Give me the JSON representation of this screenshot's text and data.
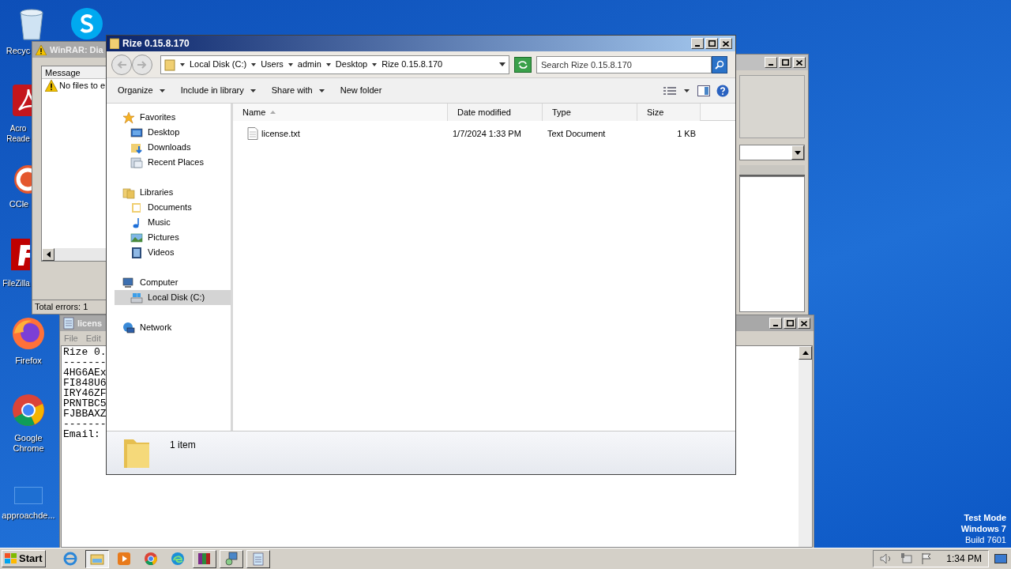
{
  "desktop": {
    "icons": [
      {
        "kind": "recycle",
        "lines": [
          "Recyc"
        ]
      },
      {
        "kind": "skype"
      },
      {
        "kind": "acrobat",
        "lines": [
          "Acro",
          "Reade"
        ]
      },
      {
        "kind": "ccleaner",
        "lines": [
          "CCle"
        ]
      },
      {
        "kind": "filezilla",
        "lines": [
          "FileZilla"
        ]
      },
      {
        "kind": "firefox",
        "lines": [
          "Firefox"
        ]
      },
      {
        "kind": "chrome",
        "lines": [
          "Google",
          "Chrome"
        ]
      },
      {
        "kind": "blank",
        "lines": [
          "approachde..."
        ]
      }
    ],
    "test_mode": [
      "Test Mode",
      "Windows 7",
      "Build 7601"
    ]
  },
  "winrar_dialog": {
    "title": "WinRAR: Dia",
    "column": "Message",
    "row": "No files to e",
    "status": "Total errors: 1"
  },
  "notepad": {
    "title": "licens",
    "menu": [
      "File",
      "Edit"
    ],
    "lines": [
      "Rize 0.",
      "-------",
      "4HG6AEx",
      "FI848U6",
      "IRY46ZF",
      "PRNTBC5",
      "FJBBAXZ",
      "-------",
      "Email:"
    ]
  },
  "explorer": {
    "title": "Rize 0.15.8.170",
    "breadcrumbs": [
      "Local Disk (C:)",
      "Users",
      "admin",
      "Desktop",
      "Rize 0.15.8.170"
    ],
    "search": {
      "placeholder": "Search Rize 0.15.8.170"
    },
    "toolbar": [
      {
        "label": "Organize",
        "has_menu": true
      },
      {
        "label": "Include in library",
        "has_menu": true
      },
      {
        "label": "Share with",
        "has_menu": true
      },
      {
        "label": "New folder",
        "has_menu": false
      }
    ],
    "nav": [
      {
        "label": "Favorites",
        "kind": "star",
        "selected": false,
        "children": [
          {
            "label": "Desktop",
            "kind": "desktop",
            "selected": false
          },
          {
            "label": "Downloads",
            "kind": "downloads",
            "selected": false
          },
          {
            "label": "Recent Places",
            "kind": "recent",
            "selected": false
          }
        ]
      },
      {
        "label": "Libraries",
        "kind": "library",
        "selected": false,
        "children": [
          {
            "label": "Documents",
            "kind": "documents",
            "selected": false
          },
          {
            "label": "Music",
            "kind": "music",
            "selected": false
          },
          {
            "label": "Pictures",
            "kind": "pictures",
            "selected": false
          },
          {
            "label": "Videos",
            "kind": "videos",
            "selected": false
          }
        ]
      },
      {
        "label": "Computer",
        "kind": "computer",
        "selected": false,
        "children": [
          {
            "label": "Local Disk (C:)",
            "kind": "drive",
            "selected": true
          }
        ]
      },
      {
        "label": "Network",
        "kind": "network",
        "selected": false
      }
    ],
    "columns": [
      {
        "label": "Name",
        "sorted": true
      },
      {
        "label": "Date modified",
        "sorted": false
      },
      {
        "label": "Type",
        "sorted": false
      },
      {
        "label": "Size",
        "sorted": false
      }
    ],
    "rows": [
      {
        "name": "license.txt",
        "date": "1/7/2024 1:33 PM",
        "type": "Text Document",
        "size": "1 KB",
        "selected": false
      }
    ],
    "status": "1 item"
  },
  "taskbar": {
    "start": "Start",
    "apps": [
      {
        "kind": "ie",
        "active": false
      },
      {
        "kind": "explorer",
        "active": true
      },
      {
        "kind": "media",
        "active": false
      },
      {
        "kind": "chrome",
        "active": false
      },
      {
        "kind": "edge",
        "active": false
      },
      {
        "kind": "winrar",
        "active": false
      },
      {
        "kind": "setup",
        "active": false
      },
      {
        "kind": "notepad",
        "active": false
      }
    ],
    "time": "1:34 PM"
  }
}
